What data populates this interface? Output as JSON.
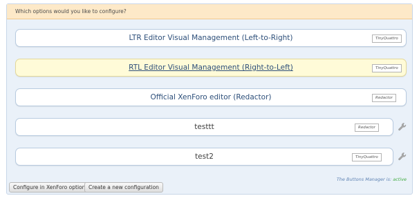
{
  "panel": {
    "header": "Which options would you like to configure?"
  },
  "editors": [
    {
      "title": "LTR Editor Visual Management (Left-to-Right)",
      "tag": "TinyQuattro"
    },
    {
      "title": "RTL Editor Visual Management (Right-to-Left)",
      "tag": "TinyQuattro"
    },
    {
      "title": "Official XenForo editor (Redactor)",
      "tag": "Redactor"
    },
    {
      "title": "testtt",
      "tag": "Redactor"
    },
    {
      "title": "test2",
      "tag": "TinyQuattro"
    }
  ],
  "status": {
    "prefix": "The Buttons Manager is:",
    "value": "active"
  },
  "buttons": {
    "configure_xenforo": "Configure in XenForo options",
    "new_config": "Create a new configuration"
  },
  "colors": {
    "header_bg": "#fde9c8",
    "panel_bg": "#eaf1f9",
    "highlight_row": "#fffbd8",
    "link_blue": "#2c4e79",
    "status_active": "#3eab3e"
  },
  "icons": {
    "edit_config": "wrench-icon"
  }
}
